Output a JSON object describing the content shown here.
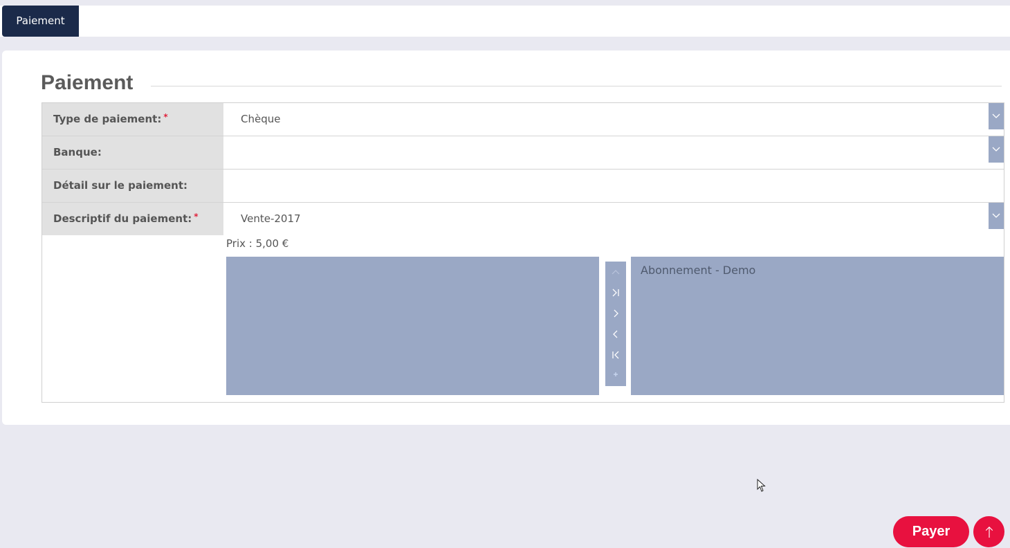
{
  "tabs": [
    {
      "label": "Paiement",
      "active": true
    }
  ],
  "section": {
    "title": "Paiement"
  },
  "form": {
    "rows": [
      {
        "label": "Type de paiement:",
        "required": true,
        "value": "Chèque",
        "has_dropdown": true
      },
      {
        "label": "Banque:",
        "required": false,
        "value": "",
        "has_dropdown": true
      },
      {
        "label": "Détail sur le paiement:",
        "required": false,
        "value": "",
        "has_dropdown": false
      },
      {
        "label": "Descriptif du paiement:",
        "required": true,
        "value": "Vente-2017",
        "has_dropdown": true
      }
    ],
    "required_mark": "*",
    "price_label": "Prix : 5,00 €",
    "available_items": [],
    "selected_items": [
      "Abonnement - Demo"
    ]
  },
  "transfer_controls": [
    "move-up-icon",
    "move-all-right-icon",
    "move-right-icon",
    "move-left-icon",
    "move-all-left-icon",
    "add-icon"
  ],
  "actions": {
    "pay_label": "Payer"
  },
  "colors": {
    "navy": "#1b2a4a",
    "accent_red": "#e8113f",
    "list_blue": "#9aa8c5",
    "label_bg": "#e1e1e1"
  }
}
